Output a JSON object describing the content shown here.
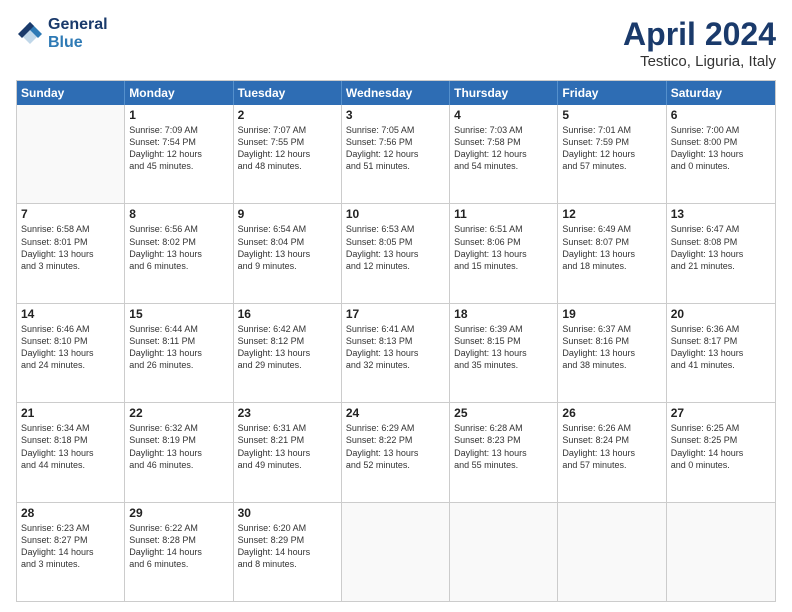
{
  "header": {
    "logo_line1": "General",
    "logo_line2": "Blue",
    "title": "April 2024",
    "subtitle": "Testico, Liguria, Italy"
  },
  "days_of_week": [
    "Sunday",
    "Monday",
    "Tuesday",
    "Wednesday",
    "Thursday",
    "Friday",
    "Saturday"
  ],
  "weeks": [
    [
      {
        "day": "",
        "lines": []
      },
      {
        "day": "1",
        "lines": [
          "Sunrise: 7:09 AM",
          "Sunset: 7:54 PM",
          "Daylight: 12 hours",
          "and 45 minutes."
        ]
      },
      {
        "day": "2",
        "lines": [
          "Sunrise: 7:07 AM",
          "Sunset: 7:55 PM",
          "Daylight: 12 hours",
          "and 48 minutes."
        ]
      },
      {
        "day": "3",
        "lines": [
          "Sunrise: 7:05 AM",
          "Sunset: 7:56 PM",
          "Daylight: 12 hours",
          "and 51 minutes."
        ]
      },
      {
        "day": "4",
        "lines": [
          "Sunrise: 7:03 AM",
          "Sunset: 7:58 PM",
          "Daylight: 12 hours",
          "and 54 minutes."
        ]
      },
      {
        "day": "5",
        "lines": [
          "Sunrise: 7:01 AM",
          "Sunset: 7:59 PM",
          "Daylight: 12 hours",
          "and 57 minutes."
        ]
      },
      {
        "day": "6",
        "lines": [
          "Sunrise: 7:00 AM",
          "Sunset: 8:00 PM",
          "Daylight: 13 hours",
          "and 0 minutes."
        ]
      }
    ],
    [
      {
        "day": "7",
        "lines": [
          "Sunrise: 6:58 AM",
          "Sunset: 8:01 PM",
          "Daylight: 13 hours",
          "and 3 minutes."
        ]
      },
      {
        "day": "8",
        "lines": [
          "Sunrise: 6:56 AM",
          "Sunset: 8:02 PM",
          "Daylight: 13 hours",
          "and 6 minutes."
        ]
      },
      {
        "day": "9",
        "lines": [
          "Sunrise: 6:54 AM",
          "Sunset: 8:04 PM",
          "Daylight: 13 hours",
          "and 9 minutes."
        ]
      },
      {
        "day": "10",
        "lines": [
          "Sunrise: 6:53 AM",
          "Sunset: 8:05 PM",
          "Daylight: 13 hours",
          "and 12 minutes."
        ]
      },
      {
        "day": "11",
        "lines": [
          "Sunrise: 6:51 AM",
          "Sunset: 8:06 PM",
          "Daylight: 13 hours",
          "and 15 minutes."
        ]
      },
      {
        "day": "12",
        "lines": [
          "Sunrise: 6:49 AM",
          "Sunset: 8:07 PM",
          "Daylight: 13 hours",
          "and 18 minutes."
        ]
      },
      {
        "day": "13",
        "lines": [
          "Sunrise: 6:47 AM",
          "Sunset: 8:08 PM",
          "Daylight: 13 hours",
          "and 21 minutes."
        ]
      }
    ],
    [
      {
        "day": "14",
        "lines": [
          "Sunrise: 6:46 AM",
          "Sunset: 8:10 PM",
          "Daylight: 13 hours",
          "and 24 minutes."
        ]
      },
      {
        "day": "15",
        "lines": [
          "Sunrise: 6:44 AM",
          "Sunset: 8:11 PM",
          "Daylight: 13 hours",
          "and 26 minutes."
        ]
      },
      {
        "day": "16",
        "lines": [
          "Sunrise: 6:42 AM",
          "Sunset: 8:12 PM",
          "Daylight: 13 hours",
          "and 29 minutes."
        ]
      },
      {
        "day": "17",
        "lines": [
          "Sunrise: 6:41 AM",
          "Sunset: 8:13 PM",
          "Daylight: 13 hours",
          "and 32 minutes."
        ]
      },
      {
        "day": "18",
        "lines": [
          "Sunrise: 6:39 AM",
          "Sunset: 8:15 PM",
          "Daylight: 13 hours",
          "and 35 minutes."
        ]
      },
      {
        "day": "19",
        "lines": [
          "Sunrise: 6:37 AM",
          "Sunset: 8:16 PM",
          "Daylight: 13 hours",
          "and 38 minutes."
        ]
      },
      {
        "day": "20",
        "lines": [
          "Sunrise: 6:36 AM",
          "Sunset: 8:17 PM",
          "Daylight: 13 hours",
          "and 41 minutes."
        ]
      }
    ],
    [
      {
        "day": "21",
        "lines": [
          "Sunrise: 6:34 AM",
          "Sunset: 8:18 PM",
          "Daylight: 13 hours",
          "and 44 minutes."
        ]
      },
      {
        "day": "22",
        "lines": [
          "Sunrise: 6:32 AM",
          "Sunset: 8:19 PM",
          "Daylight: 13 hours",
          "and 46 minutes."
        ]
      },
      {
        "day": "23",
        "lines": [
          "Sunrise: 6:31 AM",
          "Sunset: 8:21 PM",
          "Daylight: 13 hours",
          "and 49 minutes."
        ]
      },
      {
        "day": "24",
        "lines": [
          "Sunrise: 6:29 AM",
          "Sunset: 8:22 PM",
          "Daylight: 13 hours",
          "and 52 minutes."
        ]
      },
      {
        "day": "25",
        "lines": [
          "Sunrise: 6:28 AM",
          "Sunset: 8:23 PM",
          "Daylight: 13 hours",
          "and 55 minutes."
        ]
      },
      {
        "day": "26",
        "lines": [
          "Sunrise: 6:26 AM",
          "Sunset: 8:24 PM",
          "Daylight: 13 hours",
          "and 57 minutes."
        ]
      },
      {
        "day": "27",
        "lines": [
          "Sunrise: 6:25 AM",
          "Sunset: 8:25 PM",
          "Daylight: 14 hours",
          "and 0 minutes."
        ]
      }
    ],
    [
      {
        "day": "28",
        "lines": [
          "Sunrise: 6:23 AM",
          "Sunset: 8:27 PM",
          "Daylight: 14 hours",
          "and 3 minutes."
        ]
      },
      {
        "day": "29",
        "lines": [
          "Sunrise: 6:22 AM",
          "Sunset: 8:28 PM",
          "Daylight: 14 hours",
          "and 6 minutes."
        ]
      },
      {
        "day": "30",
        "lines": [
          "Sunrise: 6:20 AM",
          "Sunset: 8:29 PM",
          "Daylight: 14 hours",
          "and 8 minutes."
        ]
      },
      {
        "day": "",
        "lines": []
      },
      {
        "day": "",
        "lines": []
      },
      {
        "day": "",
        "lines": []
      },
      {
        "day": "",
        "lines": []
      }
    ]
  ]
}
